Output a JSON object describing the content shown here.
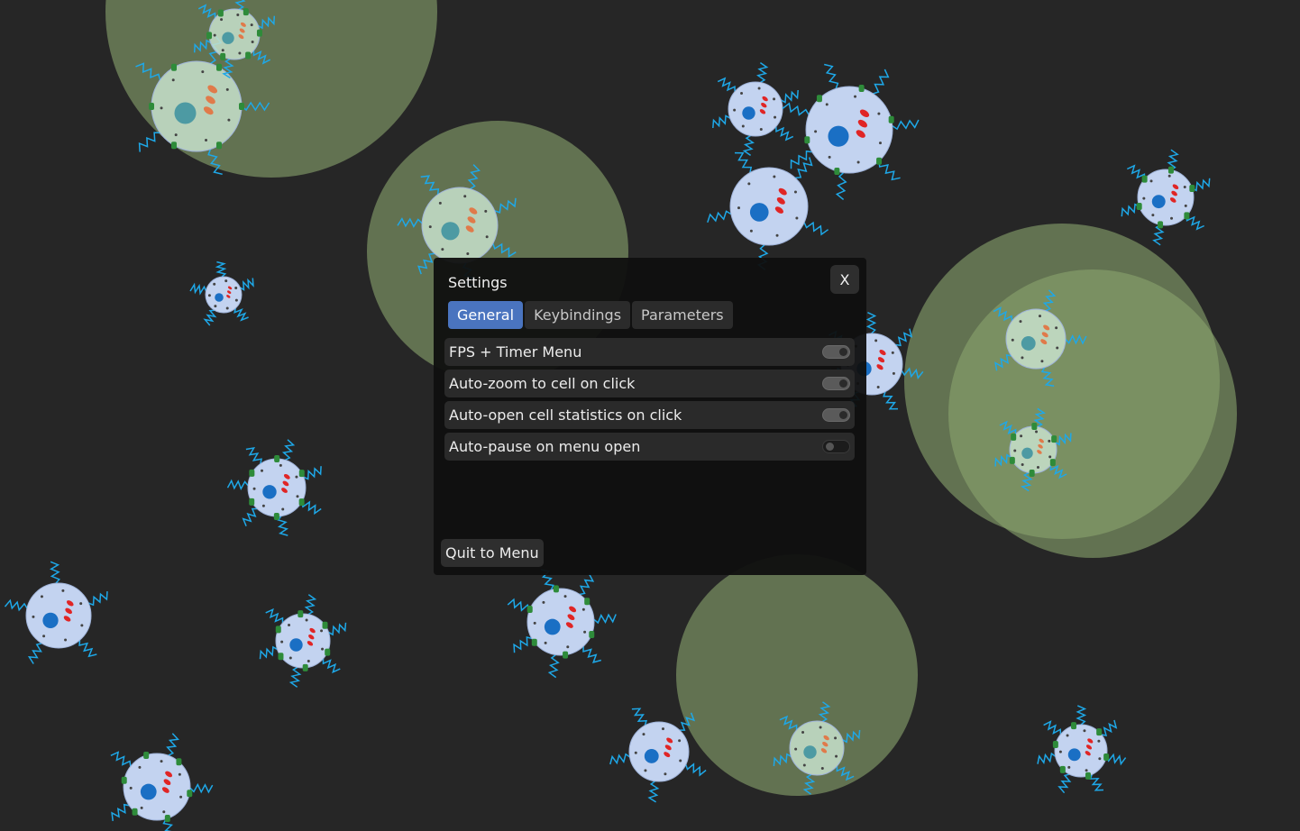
{
  "settings": {
    "title": "Settings",
    "close_label": "X",
    "tabs": [
      {
        "label": "General",
        "active": true
      },
      {
        "label": "Keybindings",
        "active": false
      },
      {
        "label": "Parameters",
        "active": false
      }
    ],
    "options": [
      {
        "label": "FPS + Timer Menu",
        "enabled": true
      },
      {
        "label": "Auto-zoom to cell on click",
        "enabled": true
      },
      {
        "label": "Auto-open cell statistics on click",
        "enabled": true
      },
      {
        "label": "Auto-pause on menu open",
        "enabled": false
      }
    ],
    "quit_label": "Quit to Menu"
  },
  "colors": {
    "background": "#262626",
    "zone": "#8aa56e",
    "cell_blue": "#c3d3f0",
    "cell_green": "#c8e2cc",
    "nucleus_blue": "#1a6fc4",
    "nucleus_teal": "#4d9aa3",
    "organelle_red": "#e02525",
    "organelle_orange": "#e07a4a",
    "flagella": "#1ea8e8",
    "receptor": "#2e8b3a",
    "accent": "#4a74bf"
  }
}
